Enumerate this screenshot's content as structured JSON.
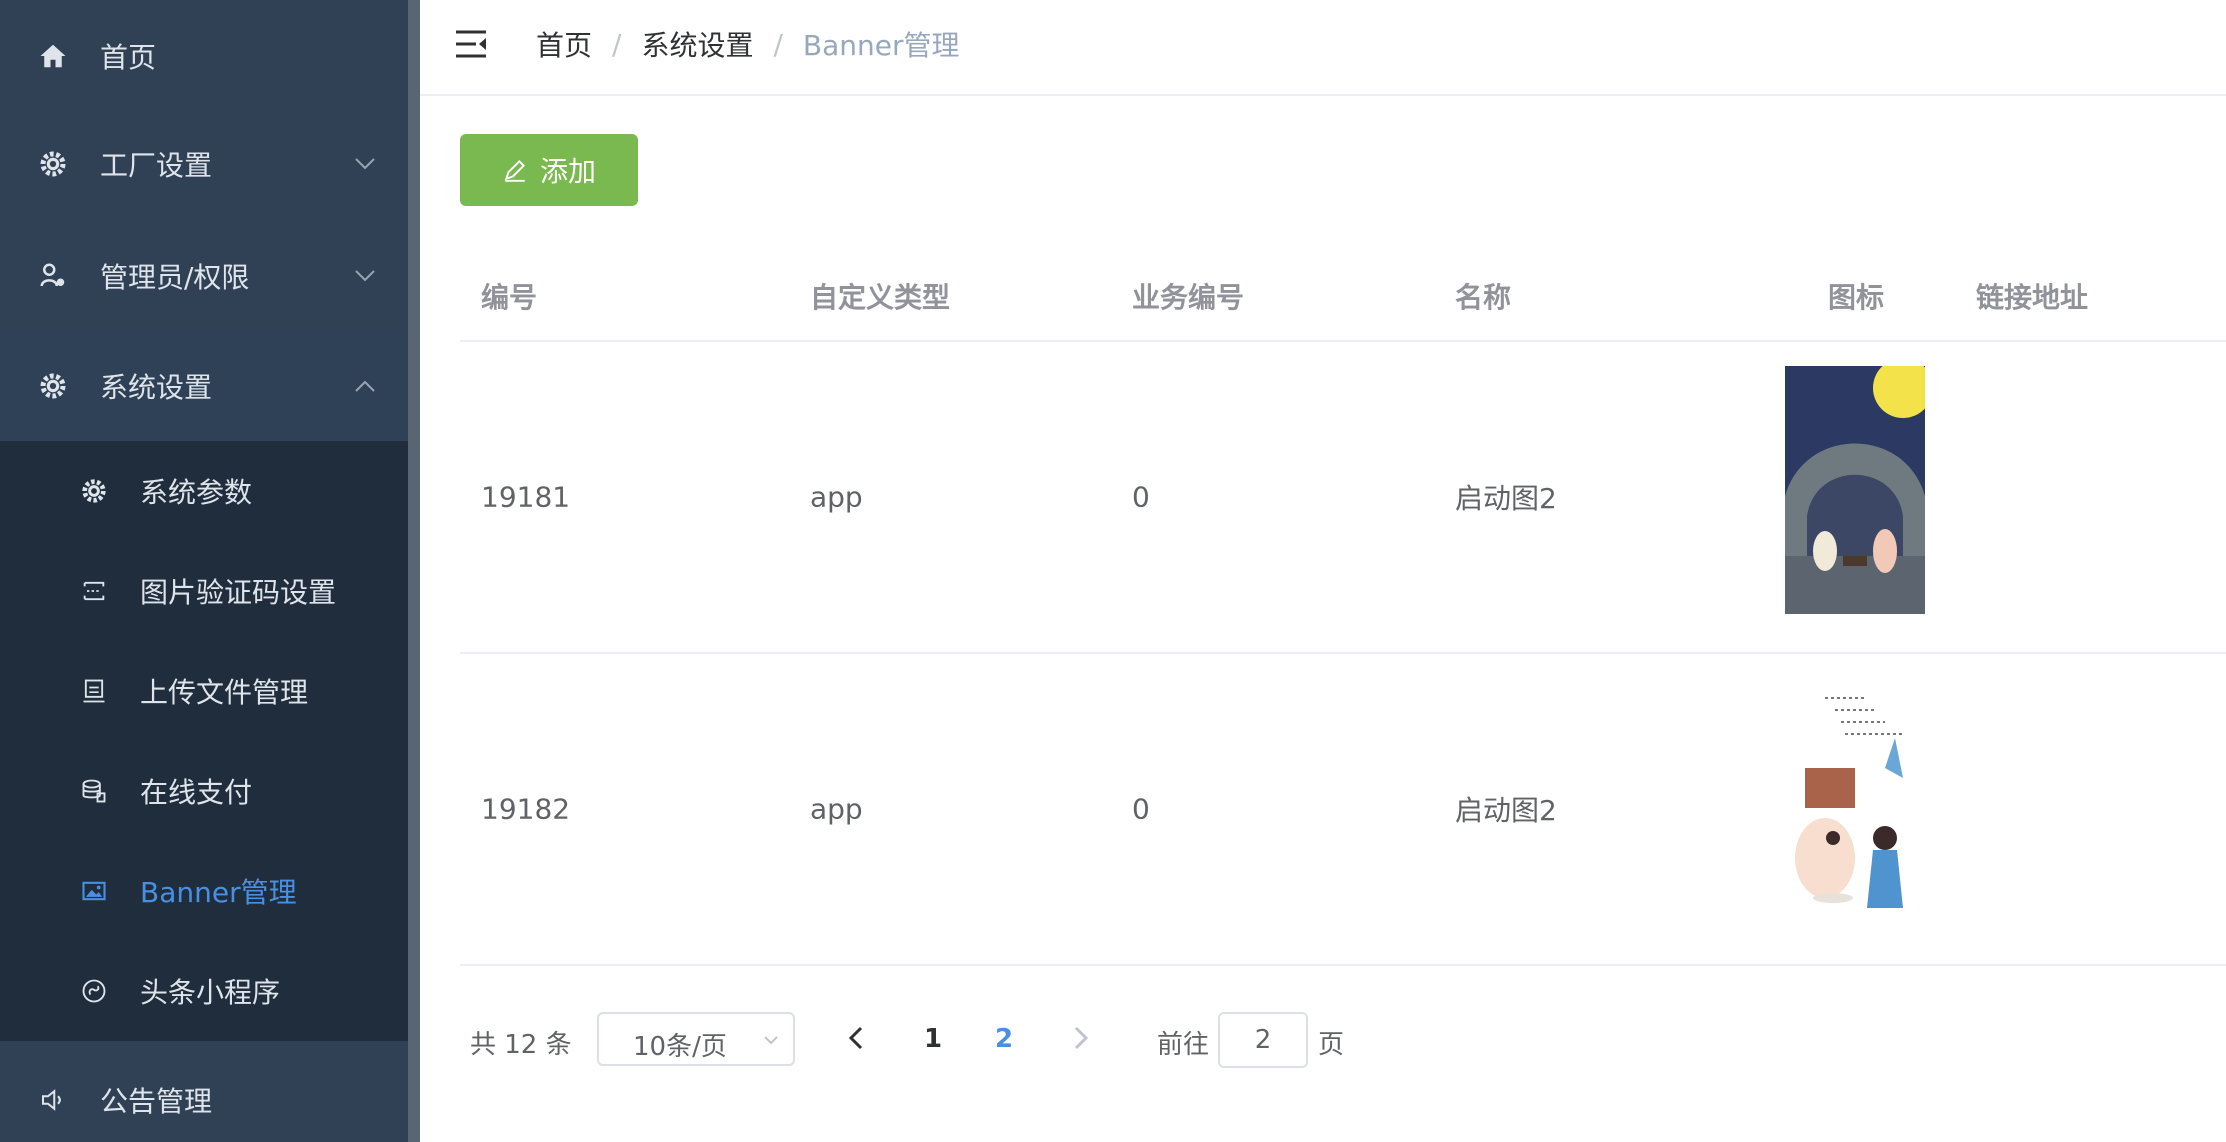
{
  "sidebar": {
    "items": [
      {
        "label": "首页",
        "icon": "home-icon"
      },
      {
        "label": "工厂设置",
        "icon": "gear-icon"
      },
      {
        "label": "管理员/权限",
        "icon": "user-key-icon"
      },
      {
        "label": "系统设置",
        "icon": "gear-icon"
      }
    ],
    "submenu": [
      {
        "label": "系统参数",
        "icon": "gear-icon"
      },
      {
        "label": "图片验证码设置",
        "icon": "captcha-icon"
      },
      {
        "label": "上传文件管理",
        "icon": "upload-icon"
      },
      {
        "label": "在线支付",
        "icon": "coins-icon"
      },
      {
        "label": "Banner管理",
        "icon": "image-icon"
      },
      {
        "label": "头条小程序",
        "icon": "miniapp-icon"
      }
    ],
    "bottom_item": {
      "label": "公告管理",
      "icon": "speaker-icon"
    }
  },
  "breadcrumb": [
    "首页",
    "系统设置",
    "Banner管理"
  ],
  "breadcrumb_sep": "/",
  "toolbar": {
    "add_label": "添加"
  },
  "table": {
    "headers": [
      "编号",
      "自定义类型",
      "业务编号",
      "名称",
      "图标",
      "链接地址"
    ],
    "rows": [
      {
        "id": "19181",
        "type": "app",
        "biz_no": "0",
        "name": "启动图2",
        "link": ""
      },
      {
        "id": "19182",
        "type": "app",
        "biz_no": "0",
        "name": "启动图2",
        "link": ""
      }
    ]
  },
  "pagination": {
    "total_text": "共 12 条",
    "page_size": "10条/页",
    "pages": [
      "1",
      "2"
    ],
    "current_page": "2",
    "goto_label": "前往",
    "goto_value": "2",
    "page_suffix": "页"
  },
  "colors": {
    "sidebar_bg": "#304156",
    "submenu_bg": "#1f2d3d",
    "active": "#4a90e2",
    "add_button": "#7ab94f"
  }
}
